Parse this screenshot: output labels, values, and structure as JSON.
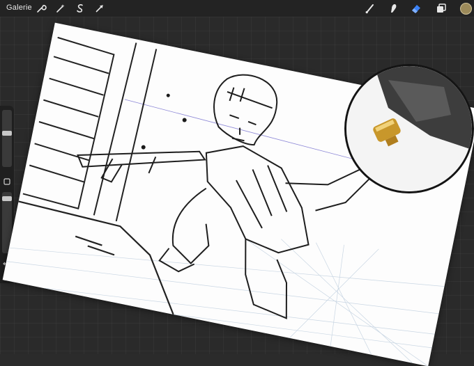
{
  "toolbar": {
    "gallery_label": "Galerie",
    "left_tools": [
      "wrench-icon",
      "magic-wand-icon",
      "selection-s-icon",
      "transform-arrow-icon"
    ],
    "right_tools": [
      "brush-icon",
      "smudge-icon",
      "eraser-icon",
      "layers-icon"
    ],
    "active_tool": "eraser-icon",
    "active_color": "#9c8a5a",
    "accent_color": "#3b82f6"
  },
  "sidebar": {
    "brush_size_level": 0.35,
    "opacity_level": 0.2,
    "undo_icon": "undo-icon",
    "redo_icon": "redo-icon",
    "modifier_icon": "square-modifier-icon"
  }
}
